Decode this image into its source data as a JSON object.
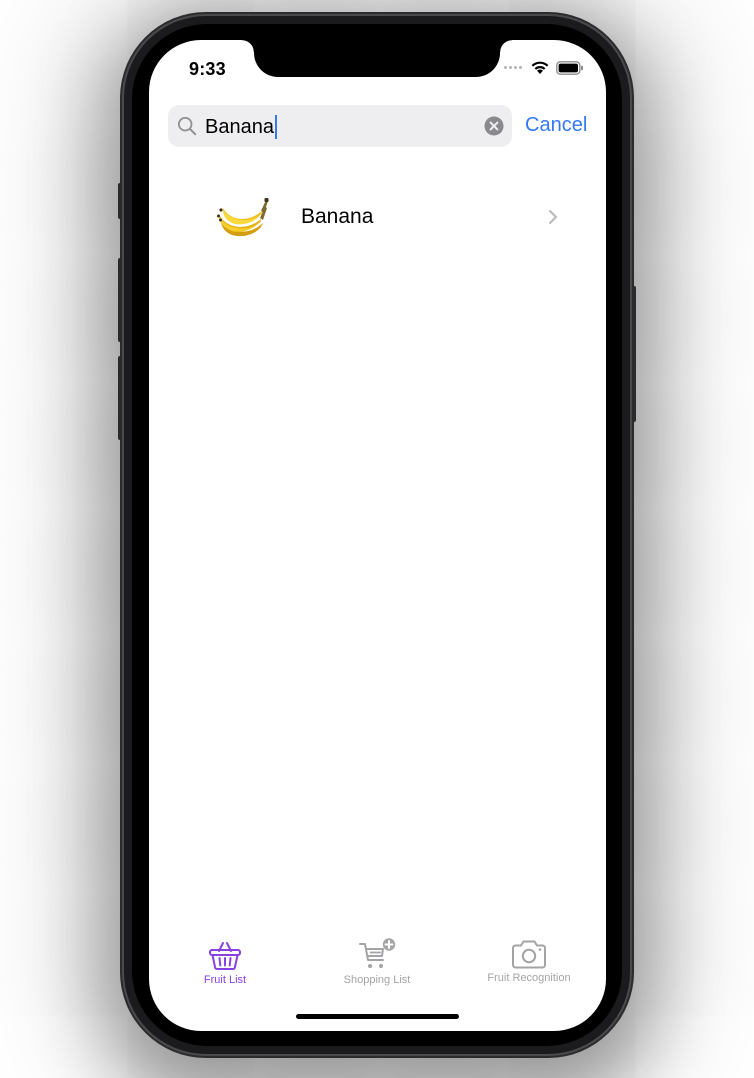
{
  "status_bar": {
    "time": "9:33",
    "icons": [
      "signal-dots-icon",
      "wifi-icon",
      "battery-icon"
    ]
  },
  "search": {
    "value": "Banana",
    "clear_icon": "clear-circle-icon",
    "cancel_label": "Cancel"
  },
  "results": [
    {
      "name": "Banana",
      "icon": "banana-image"
    }
  ],
  "tab_bar": {
    "tabs": [
      {
        "label": "Fruit List",
        "icon": "basket-icon",
        "active": true
      },
      {
        "label": "Shopping List",
        "icon": "cart-add-icon",
        "active": false
      },
      {
        "label": "Fruit Recognition",
        "icon": "camera-icon",
        "active": false
      }
    ]
  },
  "colors": {
    "accent": "#3478f6",
    "tab_active": "#8a3fe0",
    "tab_inactive": "#a4a4a6",
    "search_background": "#eeeef0"
  }
}
